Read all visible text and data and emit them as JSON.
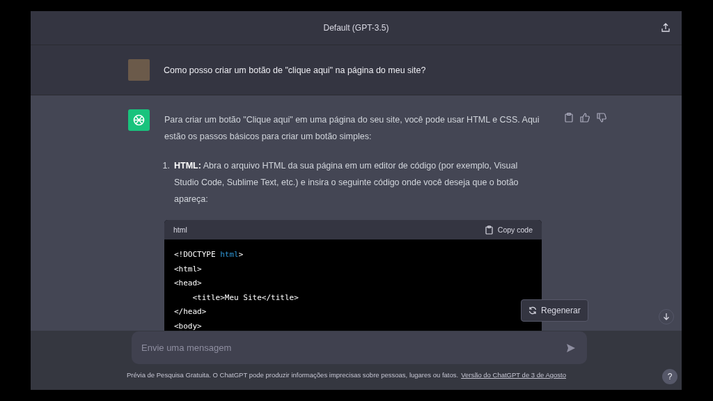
{
  "header": {
    "title": "Default (GPT-3.5)"
  },
  "user_message": {
    "text": "Como posso criar um botão de \"clique aqui\" na página do meu site?"
  },
  "assistant_message": {
    "intro": "Para criar um botão \"Clique aqui\" em uma página do seu site, você pode usar HTML e CSS. Aqui estão os passos básicos para criar um botão simples:",
    "steps": [
      {
        "number": "1.",
        "text": "**HTML:** Abra o arquivo HTML da sua página em um editor de código (por exemplo, Visual Studio Code, Sublime Text, etc.) e insira o seguinte código onde você deseja que o botão apareça:"
      }
    ],
    "code_block": {
      "language": "html",
      "copy_label": "Copy code",
      "lines": [
        [
          {
            "text": "<!DOCTYPE ",
            "kind": "plain"
          },
          {
            "text": "html",
            "kind": "keyword"
          },
          {
            "text": ">",
            "kind": "plain"
          }
        ],
        [
          {
            "text": "<html>",
            "kind": "plain"
          }
        ],
        [
          {
            "text": "<head>",
            "kind": "plain"
          }
        ],
        [
          {
            "text": "    <title>Meu Site</title>",
            "kind": "plain"
          }
        ],
        [
          {
            "text": "</head>",
            "kind": "plain"
          }
        ],
        [
          {
            "text": "<body>",
            "kind": "plain"
          }
        ]
      ]
    }
  },
  "regenerate_button": {
    "label": "Regenerar"
  },
  "composer": {
    "placeholder": "Envie uma mensagem"
  },
  "footer": {
    "text": "Prévia de Pesquisa Gratuita. O ChatGPT pode produzir informações imprecisas sobre pessoas, lugares ou fatos.",
    "link": "Versão do ChatGPT de 3 de Agosto"
  },
  "help_button": {
    "label": "?"
  }
}
